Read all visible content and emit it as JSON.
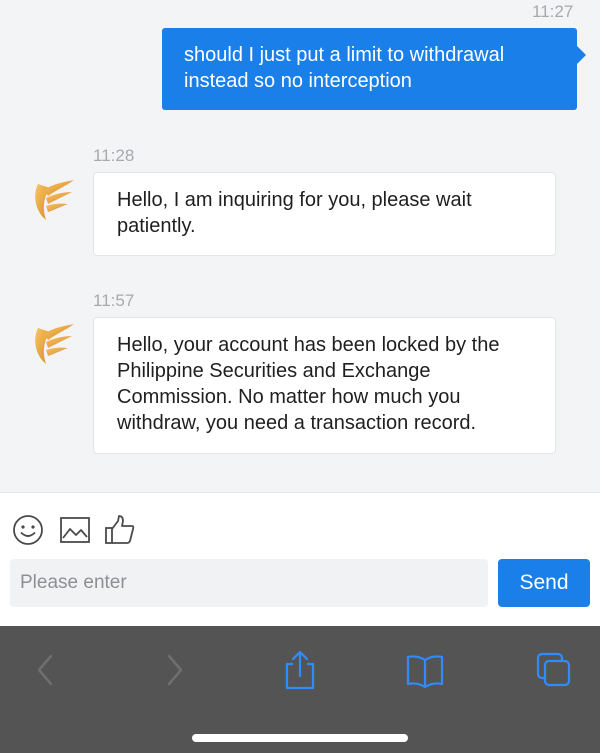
{
  "messages": [
    {
      "direction": "outgoing",
      "time": "11:27",
      "text": "should I just put a limit to withdrawal instead so no interception"
    },
    {
      "direction": "incoming",
      "time": "11:28",
      "text": "Hello, I am inquiring for you, please wait patiently.",
      "avatar": "golden-wings-logo"
    },
    {
      "direction": "incoming",
      "time": "11:57",
      "text": "Hello, your account has been locked by the Philippine Securities and Exchange Commission. No matter how much you withdraw, you need a transaction record.",
      "avatar": "golden-wings-logo"
    }
  ],
  "composer": {
    "tools": [
      "emoji-icon",
      "image-icon",
      "thumbs-up-icon"
    ],
    "input_placeholder": "Please enter",
    "input_value": "",
    "send_label": "Send"
  },
  "browser_toolbar": {
    "buttons": [
      "back-icon",
      "forward-icon",
      "share-icon",
      "bookmarks-icon",
      "tabs-icon"
    ],
    "disabled": [
      "back-icon",
      "forward-icon"
    ]
  },
  "colors": {
    "accent": "#1a7fe8",
    "chat_background": "#f3f4f6",
    "toolbar_background": "#545454",
    "toolbar_icon": "#2f8cff"
  }
}
